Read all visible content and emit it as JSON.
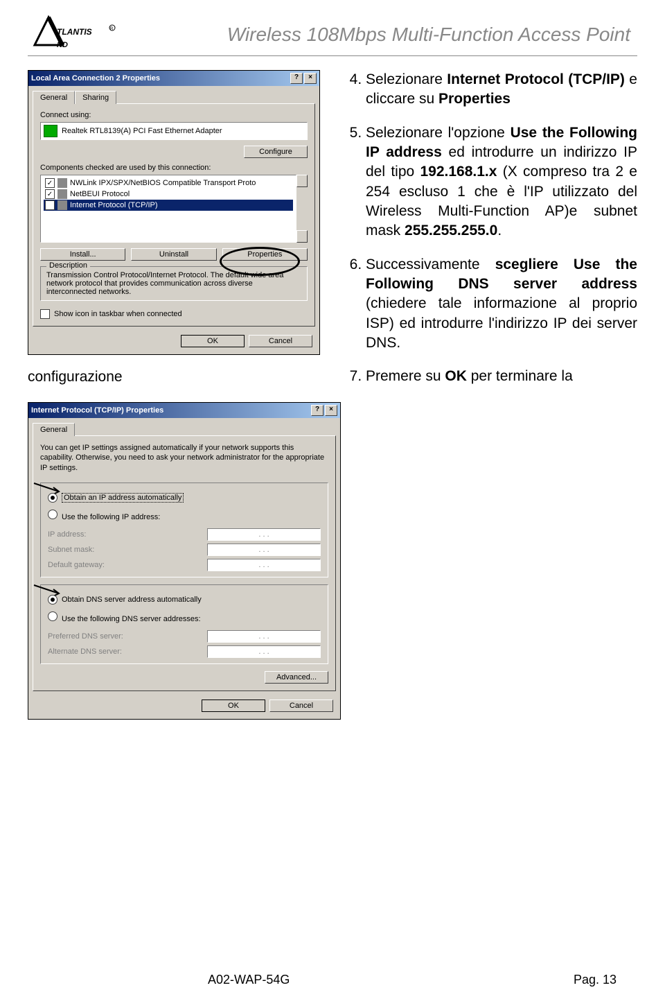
{
  "header": {
    "logo_text": "ATLANTIS AND",
    "page_title": "Wireless 108Mbps Multi-Function Access Point"
  },
  "instructions": {
    "start": 4,
    "items": [
      {
        "html": "Selezionare <b>Internet Protocol (TCP/IP)</b> e cliccare su <b>Properties</b>"
      },
      {
        "html": "Selezionare l'opzione <b>Use the Following IP address</b> ed introdurre un indirizzo IP del tipo <b>192.168.1.x</b> (X compreso tra 2 e 254 escluso 1 che è l'IP utilizzato del Wireless Multi-Function AP)e subnet mask <b>255.255.255.0</b>."
      },
      {
        "html": "Successivamente <b>scegliere Use the Following DNS server address</b> (chiedere tale informazione al proprio ISP) ed introdurre l'indirizzo IP dei server DNS."
      },
      {
        "html": "Premere su  <b>OK</b> per terminare la"
      }
    ]
  },
  "config_word": "configurazione",
  "dialog1": {
    "title": "Local Area Connection 2 Properties",
    "tabs": [
      "General",
      "Sharing"
    ],
    "connect_using_label": "Connect using:",
    "adapter": "Realtek RTL8139(A) PCI Fast Ethernet Adapter",
    "configure_btn": "Configure",
    "components_label": "Components checked are used by this connection:",
    "components": [
      "NWLink IPX/SPX/NetBIOS Compatible Transport Proto",
      "NetBEUI Protocol",
      "Internet Protocol (TCP/IP)"
    ],
    "install_btn": "Install...",
    "uninstall_btn": "Uninstall",
    "properties_btn": "Properties",
    "description_legend": "Description",
    "description_text": "Transmission Control Protocol/Internet Protocol. The default wide area network protocol that provides communication across diverse interconnected networks.",
    "show_icon": "Show icon in taskbar when connected",
    "ok": "OK",
    "cancel": "Cancel"
  },
  "dialog2": {
    "title": "Internet Protocol (TCP/IP) Properties",
    "tab": "General",
    "desc": "You can get IP settings assigned automatically if your network supports this capability. Otherwise, you need to ask your network administrator for the appropriate IP settings.",
    "radio_auto_ip": "Obtain an IP address automatically",
    "radio_use_ip": "Use the following IP address:",
    "ip_address": "IP address:",
    "subnet": "Subnet mask:",
    "gateway": "Default gateway:",
    "radio_auto_dns": "Obtain DNS server address automatically",
    "radio_use_dns": "Use the following DNS server addresses:",
    "pref_dns": "Preferred DNS server:",
    "alt_dns": "Alternate DNS server:",
    "advanced": "Advanced...",
    "ok": "OK",
    "cancel": "Cancel"
  },
  "footer": {
    "left": "A02-WAP-54G",
    "right": "Pag. 13"
  }
}
